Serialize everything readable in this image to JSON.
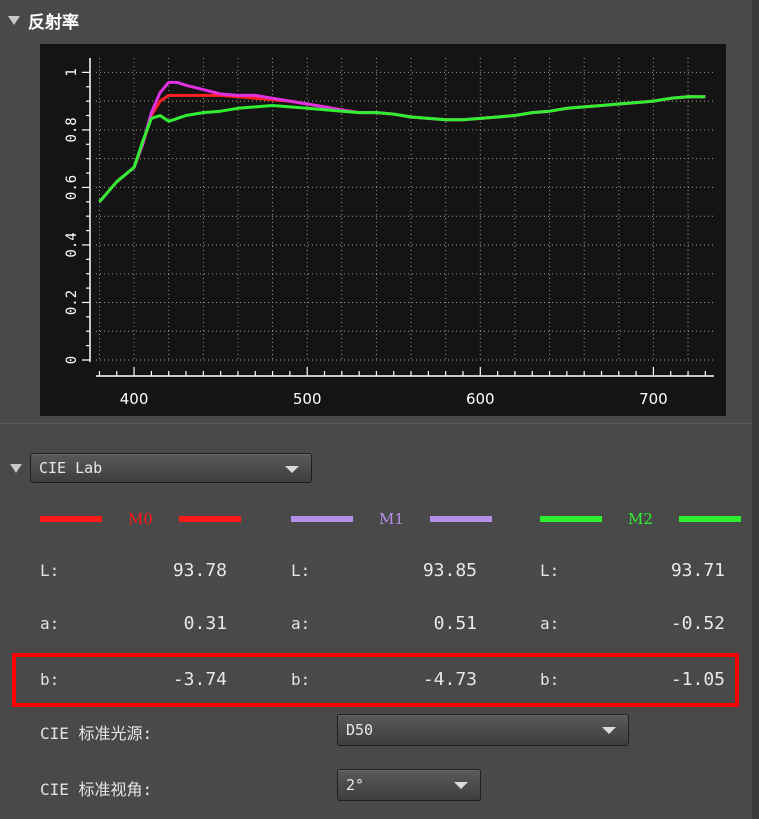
{
  "reflectance": {
    "title": "反射率"
  },
  "chart_data": {
    "type": "line",
    "xlim": [
      378,
      735
    ],
    "ylim": [
      0,
      1.05
    ],
    "xticks": [
      "400",
      "500",
      "600",
      "700"
    ],
    "yticks": [
      "0",
      "0.2",
      "0.4",
      "0.6",
      "0.8",
      "1"
    ],
    "grid": true,
    "series": [
      {
        "name": "M0",
        "color": "#ff2020",
        "x": [
          380,
          390,
          400,
          405,
          410,
          415,
          420,
          425,
          430,
          440,
          450,
          460,
          470,
          480,
          490,
          500,
          510,
          520,
          530,
          540,
          550,
          560,
          570,
          580,
          590,
          600,
          610,
          620,
          630,
          640,
          650,
          660,
          670,
          680,
          690,
          700,
          710,
          720,
          730
        ],
        "y": [
          0.55,
          0.62,
          0.67,
          0.75,
          0.85,
          0.9,
          0.92,
          0.92,
          0.92,
          0.92,
          0.92,
          0.915,
          0.91,
          0.905,
          0.9,
          0.89,
          0.88,
          0.87,
          0.86,
          0.86,
          0.855,
          0.845,
          0.84,
          0.835,
          0.835,
          0.84,
          0.845,
          0.85,
          0.86,
          0.865,
          0.875,
          0.88,
          0.885,
          0.89,
          0.895,
          0.9,
          0.91,
          0.915,
          0.915
        ]
      },
      {
        "name": "M1",
        "color": "#e030e0",
        "x": [
          380,
          390,
          400,
          405,
          410,
          415,
          420,
          425,
          430,
          440,
          450,
          460,
          470,
          480,
          490,
          500,
          510,
          520,
          530,
          540,
          550,
          560,
          570,
          580,
          590,
          600,
          610,
          620,
          630,
          640,
          650,
          660,
          670,
          680,
          690,
          700,
          710,
          720,
          730
        ],
        "y": [
          0.55,
          0.62,
          0.67,
          0.75,
          0.86,
          0.93,
          0.965,
          0.965,
          0.955,
          0.94,
          0.925,
          0.92,
          0.92,
          0.91,
          0.9,
          0.89,
          0.88,
          0.87,
          0.86,
          0.86,
          0.855,
          0.845,
          0.84,
          0.835,
          0.835,
          0.84,
          0.845,
          0.85,
          0.86,
          0.865,
          0.875,
          0.88,
          0.885,
          0.89,
          0.895,
          0.9,
          0.91,
          0.915,
          0.915
        ]
      },
      {
        "name": "M2",
        "color": "#30ee30",
        "x": [
          380,
          390,
          400,
          405,
          410,
          415,
          420,
          425,
          430,
          440,
          450,
          460,
          470,
          480,
          490,
          500,
          510,
          520,
          530,
          540,
          550,
          560,
          570,
          580,
          590,
          600,
          610,
          620,
          630,
          640,
          650,
          660,
          670,
          680,
          690,
          700,
          710,
          720,
          730
        ],
        "y": [
          0.55,
          0.62,
          0.67,
          0.76,
          0.84,
          0.85,
          0.83,
          0.84,
          0.85,
          0.86,
          0.865,
          0.875,
          0.88,
          0.885,
          0.88,
          0.875,
          0.87,
          0.865,
          0.86,
          0.86,
          0.855,
          0.845,
          0.84,
          0.835,
          0.835,
          0.84,
          0.845,
          0.85,
          0.86,
          0.865,
          0.875,
          0.88,
          0.885,
          0.89,
          0.895,
          0.9,
          0.91,
          0.915,
          0.915
        ]
      }
    ]
  },
  "lab": {
    "mode_select": "CIE Lab",
    "samples": [
      {
        "name": "M0",
        "color": "#ff1a1a",
        "L_label": "L:",
        "L": "93.78",
        "a_label": "a:",
        "a": "0.31",
        "b_label": "b:",
        "b": "-3.74"
      },
      {
        "name": "M1",
        "color": "#b48ee8",
        "L_label": "L:",
        "L": "93.85",
        "a_label": "a:",
        "a": "0.51",
        "b_label": "b:",
        "b": "-4.73"
      },
      {
        "name": "M2",
        "color": "#2ef02e",
        "L_label": "L:",
        "L": "93.71",
        "a_label": "a:",
        "a": "-0.52",
        "b_label": "b:",
        "b": "-1.05"
      }
    ]
  },
  "settings": {
    "illuminant_label": "CIE 标准光源:",
    "illuminant_value": "D50",
    "observer_label": "CIE 标准视角:",
    "observer_value": "2°"
  }
}
